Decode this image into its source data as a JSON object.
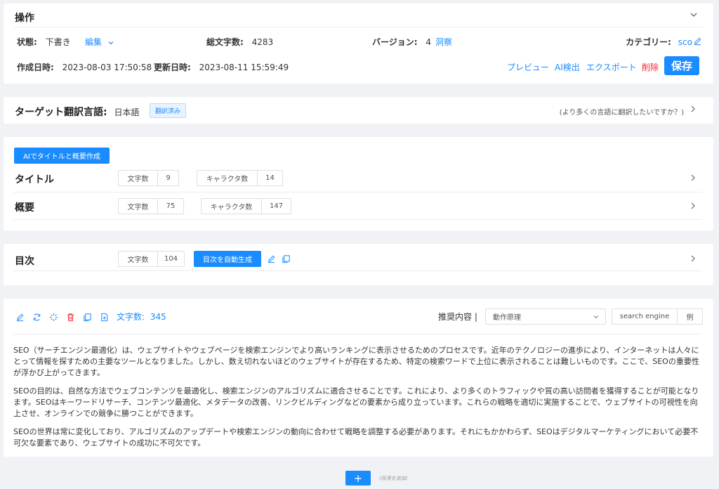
{
  "ops": {
    "heading": "操作",
    "status_label": "状態:",
    "status_value": "下書き",
    "edit_label": "編集",
    "chars_label": "総文字数:",
    "chars_value": "4283",
    "version_label": "バージョン:",
    "version_value": "4",
    "version_link": "洞察",
    "category_label": "カテゴリー:",
    "category_value": "sco",
    "created_label": "作成日時:",
    "created_value": "2023-08-03 17:50:58",
    "updated_label": "更新日時:",
    "updated_value": "2023-08-11 15:59:49",
    "preview": "プレビュー",
    "ai_detect": "AI検出",
    "export": "エクスポート",
    "delete": "削除",
    "save": "保存"
  },
  "target": {
    "label": "ターゲット翻訳言語:",
    "language": "日本語",
    "badge": "翻訳済み",
    "more": "(より多くの言語に翻訳したいですか？)"
  },
  "title_section": {
    "ai_button": "AIでタイトルと概要作成",
    "title_label": "タイトル",
    "summary_label": "概要",
    "word_count_label": "文字数",
    "char_count_label": "キャラクタ数",
    "title_words": "9",
    "title_chars": "14",
    "summary_words": "75",
    "summary_chars": "147"
  },
  "toc": {
    "label": "目次",
    "word_count_label": "文字数",
    "word_count": "104",
    "auto_button": "目次を自動生成"
  },
  "content": {
    "word_count_label": "文字数:",
    "word_count": "345",
    "recommend_label": "推奨内容 |",
    "select_value": "動作原理",
    "keyword": "search engine",
    "example": "例",
    "paragraphs": [
      "SEO（サーチエンジン最適化）は、ウェブサイトやウェブページを検索エンジンでより高いランキングに表示させるためのプロセスです。近年のテクノロジーの進歩により、インターネットは人々にとって情報を探すための主要なツールとなりました。しかし、数え切れないほどのウェブサイトが存在するため、特定の検索ワードで上位に表示されることは難しいものです。ここで、SEOの重要性が浮かび上がってきます。",
      "SEOの目的は、自然な方法でウェブコンテンツを最適化し、検索エンジンのアルゴリズムに適合させることです。これにより、より多くのトラフィックや質の高い訪問者を獲得することが可能となります。SEOはキーワードリサーチ、コンテンツ最適化、メタデータの改善、リンクビルディングなどの要素から成り立っています。これらの戦略を適切に実施することで、ウェブサイトの可視性を向上させ、オンラインでの競争に勝つことができます。",
      "SEOの世界は常に変化しており、アルゴリズムのアップデートや検索エンジンの動向に合わせて戦略を調整する必要があります。それにもかかわらず、SEOはデジタルマーケティングにおいて必要不可欠な要素であり、ウェブサイトの成功に不可欠です。"
    ]
  },
  "footer": {
    "add_button": "+",
    "add_hint": "(段落を追加)"
  },
  "colors": {
    "accent": "#1a8cff",
    "danger": "#f5222d",
    "background": "#f0f2f5"
  }
}
